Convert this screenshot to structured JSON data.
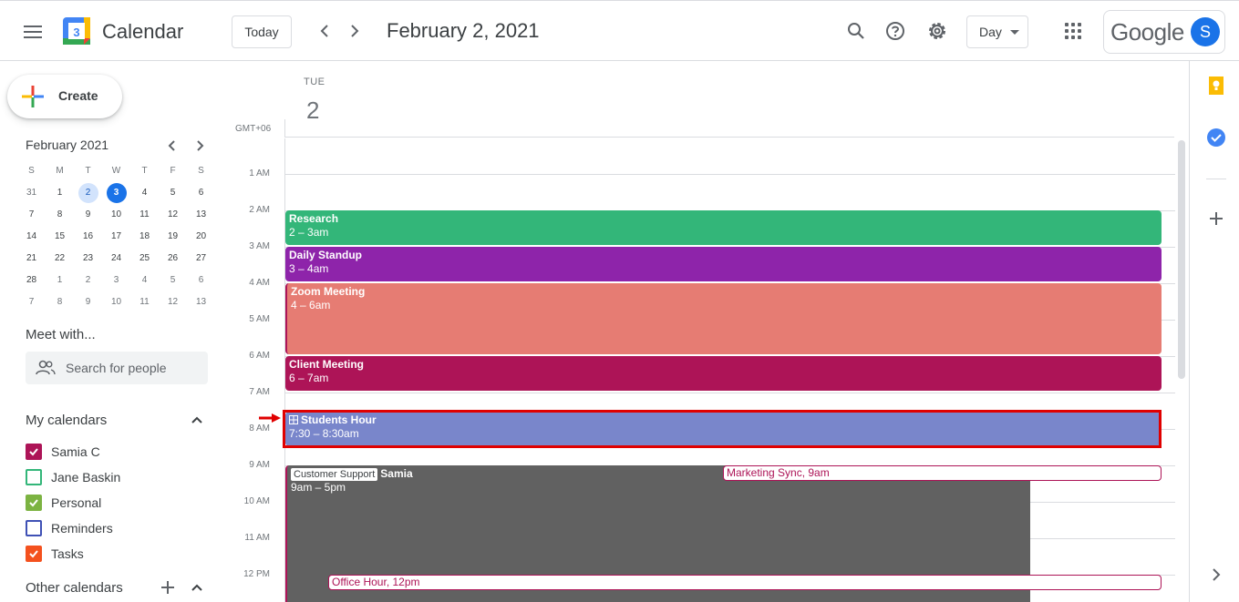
{
  "header": {
    "app_title": "Calendar",
    "logo_number": "3",
    "today_label": "Today",
    "prev_icon": "chevron-left-icon",
    "next_icon": "chevron-right-icon",
    "date_title": "February 2, 2021",
    "view_label": "Day",
    "google_word": "Google",
    "avatar_letter": "S"
  },
  "sidebar": {
    "create_label": "Create",
    "mini_calendar": {
      "title": "February 2021",
      "dow": [
        "S",
        "M",
        "T",
        "W",
        "T",
        "F",
        "S"
      ],
      "weeks": [
        [
          "31",
          "1",
          "2",
          "3",
          "4",
          "5",
          "6"
        ],
        [
          "7",
          "8",
          "9",
          "10",
          "11",
          "12",
          "13"
        ],
        [
          "14",
          "15",
          "16",
          "17",
          "18",
          "19",
          "20"
        ],
        [
          "21",
          "22",
          "23",
          "24",
          "25",
          "26",
          "27"
        ],
        [
          "28",
          "1",
          "2",
          "3",
          "4",
          "5",
          "6"
        ],
        [
          "7",
          "8",
          "9",
          "10",
          "11",
          "12",
          "13"
        ]
      ],
      "selected": "2",
      "today": "3"
    },
    "meet_with_title": "Meet with...",
    "search_people_placeholder": "Search for people",
    "my_calendars_title": "My calendars",
    "my_calendars": [
      {
        "name": "Samia C",
        "color": "#ad1457",
        "checked": true
      },
      {
        "name": "Jane Baskin",
        "color": "#33b679",
        "checked": false
      },
      {
        "name": "Personal",
        "color": "#7cb342",
        "checked": true
      },
      {
        "name": "Reminders",
        "color": "#3f51b5",
        "checked": false
      },
      {
        "name": "Tasks",
        "color": "#f4511e",
        "checked": true
      }
    ],
    "other_calendars_title": "Other calendars"
  },
  "day_view": {
    "dow": "TUE",
    "day_number": "2",
    "timezone": "GMT+06",
    "hours": [
      "1 AM",
      "2 AM",
      "3 AM",
      "4 AM",
      "5 AM",
      "6 AM",
      "7 AM",
      "8 AM",
      "9 AM",
      "10 AM",
      "11 AM",
      "12 PM"
    ],
    "events": {
      "research": {
        "title": "Research",
        "time": "2 – 3am",
        "color": "#33b679"
      },
      "standup": {
        "title": "Daily Standup",
        "time": "3 – 4am",
        "color": "#8e24aa"
      },
      "zoom": {
        "title": "Zoom Meeting",
        "time": "4 – 6am",
        "color": "#e67c73"
      },
      "client": {
        "title": "Client Meeting",
        "time": "6 – 7am",
        "color": "#ad1457"
      },
      "students": {
        "title": "Students Hour",
        "time": "7:30 – 8:30am",
        "color": "#7986cb"
      },
      "support": {
        "tag": "Customer Support",
        "title": "Samia",
        "time": "9am – 5pm",
        "color": "#616161"
      }
    },
    "chips": {
      "marketing": {
        "name": "Marketing Sync",
        "time": ", 9am"
      },
      "office": {
        "name": "Office Hour",
        "time": ", 12pm"
      }
    }
  },
  "side_panel": {
    "icons": [
      "keep-icon",
      "tasks-icon",
      "add-icon",
      "chevron-right-icon"
    ]
  }
}
